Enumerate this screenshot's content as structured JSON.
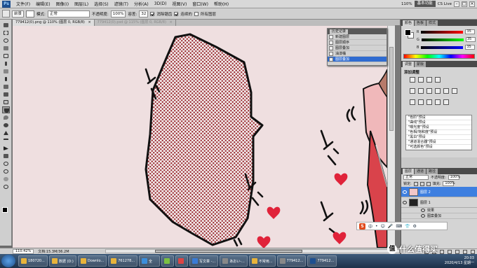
{
  "menubar": {
    "items": [
      "文件(F)",
      "编辑(E)",
      "图像(I)",
      "图层(L)",
      "选择(S)",
      "滤镜(T)",
      "分析(A)",
      "3D(D)",
      "视图(V)",
      "窗口(W)",
      "帮助(H)"
    ],
    "zoom": "110%",
    "workspace": "基本功能",
    "cs_live": "CS Live"
  },
  "optbar": {
    "mode_label": "模式:",
    "mode_value": "正常",
    "preset": "前景",
    "opacity_label": "不透明度:",
    "opacity_value": "100%",
    "tolerance_label": "容差:",
    "tolerance_value": "32",
    "antialias_label": "消除锯齿",
    "contiguous_label": "连续的",
    "alllayers_label": "所有图层"
  },
  "tabs": [
    {
      "label": "779412(0).png @ 110% (图层 0, RGB/8)",
      "close": "×"
    },
    {
      "label": "779412(0).psd @ 115% (图层 0, RGB/8)",
      "close": "×"
    }
  ],
  "status": {
    "zoom": "110.42%",
    "doc": "文档:15.3M/36.2M"
  },
  "history": {
    "tab": "历史记录",
    "rows": [
      "新建图层",
      "图层顺序",
      "图层叠加",
      "油漆桶",
      "图层叠加"
    ]
  },
  "color_panel": {
    "tabs": [
      "颜色",
      "色板",
      "样式"
    ],
    "sliders": [
      {
        "label": "R",
        "value": "35",
        "color": "#d02020"
      },
      {
        "label": "G",
        "value": "35",
        "color": "#20b020"
      },
      {
        "label": "B",
        "value": "35",
        "color": "#2050d0"
      }
    ]
  },
  "adjust_panel": {
    "tabs": [
      "调整",
      "蒙版"
    ],
    "title": "添加调整",
    "presets": [
      "\"色阶\"预设",
      "\"曲线\"预设",
      "\"曝光度\"预设",
      "\"色相/饱和度\"预设",
      "\"黑白\"预设",
      "\"通道混合器\"预设",
      "\"可选颜色\"预设"
    ]
  },
  "layers_panel": {
    "tabs": [
      "图层",
      "通道",
      "路径"
    ],
    "blend": "正常",
    "opacity_label": "不透明度:",
    "opacity_value": "100%",
    "lock_label": "锁定:",
    "fill_label": "填充:",
    "fill_value": "100%",
    "layers": [
      {
        "name": "图层 2",
        "active": true
      },
      {
        "name": "图层 1",
        "active": false
      }
    ],
    "fx_label": "效果",
    "fx_item": "图案叠加"
  },
  "taskbar": {
    "tasks": [
      {
        "label": "180720...",
        "color": "#e8b33b"
      },
      {
        "label": "数据 (D:)",
        "color": "#e8b33b"
      },
      {
        "label": "Downlo...",
        "color": "#e8b33b"
      },
      {
        "label": "761278...",
        "color": "#e8b33b"
      },
      {
        "label": "全",
        "color": "#3c8edb"
      },
      {
        "label": "",
        "color": "#7bc043"
      },
      {
        "label": "",
        "color": "#d44"
      },
      {
        "label": "写文章 -...",
        "color": "#3a7bd5"
      },
      {
        "label": "あおい-...",
        "color": "#888"
      },
      {
        "label": "不常用...",
        "color": "#e8b33b"
      },
      {
        "label": "779412...",
        "color": "#888"
      },
      {
        "label": "779412...",
        "color": "#1e4f8f"
      }
    ],
    "time": "20:03",
    "date": "2020/4/13 星期一"
  },
  "watermark": {
    "text": "什么值得买",
    "symbol": "值"
  },
  "ime": {
    "logo": "S",
    "items": [
      "中",
      "•",
      "☺",
      "🎤",
      "⌨",
      "👕",
      "⚙"
    ]
  }
}
